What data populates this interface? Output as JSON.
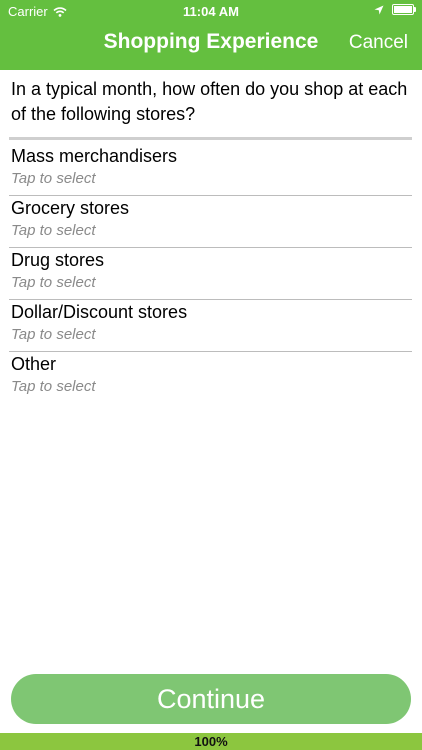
{
  "status_bar": {
    "carrier": "Carrier",
    "time": "11:04 AM",
    "battery_level": 1.0
  },
  "nav": {
    "title": "Shopping Experience",
    "cancel_label": "Cancel"
  },
  "question": {
    "text": "In a typical month, how often do you shop at each of the following stores?"
  },
  "stores": [
    {
      "label": "Mass merchandisers",
      "hint": "Tap to select"
    },
    {
      "label": "Grocery stores",
      "hint": "Tap to select"
    },
    {
      "label": "Drug stores",
      "hint": "Tap to select"
    },
    {
      "label": "Dollar/Discount stores",
      "hint": "Tap to select"
    },
    {
      "label": "Other",
      "hint": "Tap to select"
    }
  ],
  "continue_label": "Continue",
  "progress": {
    "value": 1.0,
    "label": "100%"
  },
  "colors": {
    "header": "#64bf3f",
    "continue_button": "#7fc673",
    "progress_fill": "#8cc63f"
  }
}
